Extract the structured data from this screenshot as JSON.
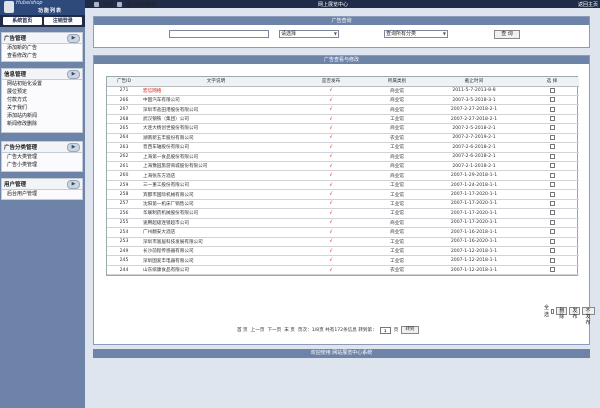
{
  "topbar": {
    "left": "欢迎",
    "progress": "进入控制面板",
    "center": "网上展览中心",
    "right": "返回主页"
  },
  "sidebar": {
    "logo_brand": "Hubeishop",
    "logo_sub": "功能列表",
    "tabs": [
      "系统首页",
      "注销登录"
    ],
    "groups": [
      {
        "title": "广告管理",
        "items": [
          "添加新的广告",
          "查看修改广告"
        ]
      },
      {
        "title": "信息管理",
        "items": [
          "网站初始化设置",
          "展位预定",
          "付款方式",
          "关于我们",
          "添加站内新闻",
          "新闻修改删除"
        ]
      },
      {
        "title": "广告分类管理",
        "items": [
          "广告大类管理",
          "广告小类管理"
        ]
      },
      {
        "title": "用户管理",
        "items": [
          "后台用户管理"
        ]
      }
    ]
  },
  "search": {
    "title": "广告查询",
    "input_value": "",
    "select1": "请选择",
    "select2": "查询所有分类",
    "button": "查 询"
  },
  "list": {
    "title": "广告查看与修改",
    "columns": [
      "广告ID",
      "文字说明",
      "是否发布",
      "所属类别",
      "截止时间",
      "选 择"
    ],
    "rows": [
      {
        "id": "271",
        "text": "宏信网络",
        "pub": "√",
        "cat": "商业馆",
        "date": "2011-5-7-2013-8-8"
      },
      {
        "id": "266",
        "text": "中国汽车有限公司",
        "pub": "√",
        "cat": "商业馆",
        "date": "2007-3-5-2018-3-1"
      },
      {
        "id": "267",
        "text": "深圳市盐田港股份有限公司",
        "pub": "√",
        "cat": "商业馆",
        "date": "2007-2-27-2018-2-1"
      },
      {
        "id": "268",
        "text": "武汉钢铁（集团）公司",
        "pub": "√",
        "cat": "工业馆",
        "date": "2007-2-27-2018-2-1"
      },
      {
        "id": "265",
        "text": "大连大杨创世股份有限公司",
        "pub": "√",
        "cat": "商业馆",
        "date": "2007-2-5-2018-2-1"
      },
      {
        "id": "264",
        "text": "湖南新五丰股份有限公司",
        "pub": "√",
        "cat": "农业馆",
        "date": "2007-2-7-2019-2-1"
      },
      {
        "id": "263",
        "text": "晋西车轴股份有限公司",
        "pub": "√",
        "cat": "工业馆",
        "date": "2007-2-6-2018-2-1"
      },
      {
        "id": "262",
        "text": "上海第一食品股份有限公司",
        "pub": "√",
        "cat": "商业馆",
        "date": "2007-2-6-2018-2-1"
      },
      {
        "id": "261",
        "text": "上海豫园旅游商城股份有限公司",
        "pub": "√",
        "cat": "商业馆",
        "date": "2007-2-1-2018-2-1"
      },
      {
        "id": "260",
        "text": "上海张东方酒店",
        "pub": "√",
        "cat": "商业馆",
        "date": "2007-1-29-2018-1-1"
      },
      {
        "id": "259",
        "text": "三一重工股份有限公司",
        "pub": "√",
        "cat": "工业馆",
        "date": "2007-1-24-2018-1-1"
      },
      {
        "id": "258",
        "text": "宾都市国际机械有限公司",
        "pub": "√",
        "cat": "工业馆",
        "date": "2007-1-17-2020-1-1"
      },
      {
        "id": "257",
        "text": "沈阳第一机床厂销售公司",
        "pub": "√",
        "cat": "工业馆",
        "date": "2007-1-17-2020-1-1"
      },
      {
        "id": "256",
        "text": "华联制药机械股份有限公司",
        "pub": "√",
        "cat": "工业馆",
        "date": "2007-1-17-2020-1-1"
      },
      {
        "id": "255",
        "text": "速腾超级连锁超市公司",
        "pub": "√",
        "cat": "商业馆",
        "date": "2007-1-17-2020-1-1"
      },
      {
        "id": "254",
        "text": "广州翻安大酒店",
        "pub": "√",
        "cat": "商业馆",
        "date": "2007-1-16-2018-1-1"
      },
      {
        "id": "253",
        "text": "深圳市富居科技发展有限公司",
        "pub": "√",
        "cat": "工业馆",
        "date": "2007-1-16-2020-1-1"
      },
      {
        "id": "249",
        "text": "长沙前程传感器有限公司",
        "pub": "√",
        "cat": "工业馆",
        "date": "2007-1-12-2018-1-1"
      },
      {
        "id": "245",
        "text": "深圳国爱丰电器有限公司",
        "pub": "√",
        "cat": "工业馆",
        "date": "2007-1-12-2018-1-1"
      },
      {
        "id": "244",
        "text": "山东缤康食品有限公司",
        "pub": "√",
        "cat": "农业馆",
        "date": "2007-1-12-2018-1-1"
      }
    ],
    "select_all": "全选",
    "delete": "删 除",
    "publish": "发布",
    "unpublish": "不发布"
  },
  "pager": {
    "first": "首 页",
    "prev": "上一页",
    "next": "下一页",
    "last": "末 页",
    "info": "页次：1/8页 共有172条信息 转到第：",
    "page_value": "1",
    "page_unit": "页",
    "go": "转到"
  },
  "footer": {
    "text": "欢迎使用 网站展览中心系统"
  }
}
